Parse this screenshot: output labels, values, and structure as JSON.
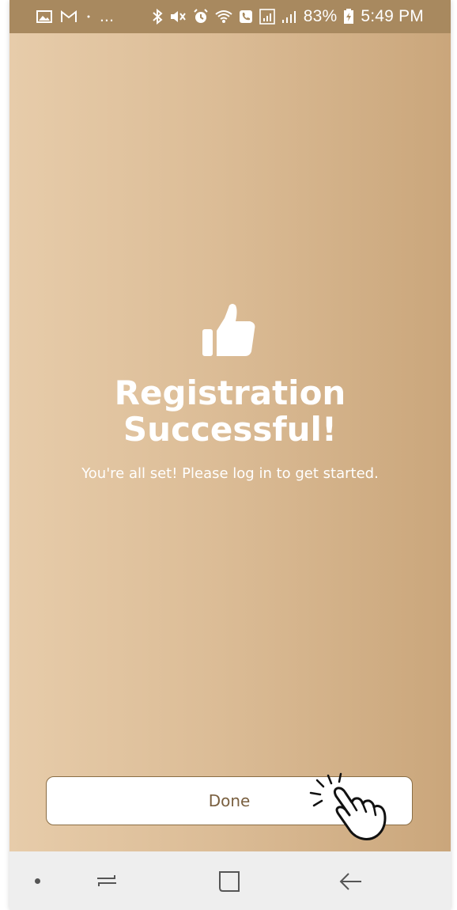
{
  "status_bar": {
    "overflow_dots": "...",
    "battery_percent": "83%",
    "time": "5:49 PM",
    "icons": [
      "gallery-icon",
      "gmail-icon",
      "dot-icon",
      "bluetooth-icon",
      "mute-icon",
      "alarm-icon",
      "wifi-icon",
      "phone-icon",
      "signal-box-icon",
      "signal-bars-icon",
      "battery-charging-icon"
    ]
  },
  "success": {
    "icon": "thumbs-up-icon",
    "title_line1": "Registration",
    "title_line2": "Successful!",
    "message": "You're all set! Please log in to get started."
  },
  "actions": {
    "done_label": "Done"
  },
  "navigation": {
    "icons": [
      "nav-dot-icon",
      "recent-apps-icon",
      "home-icon",
      "back-icon"
    ]
  },
  "colors": {
    "status_bar": "#a8895f",
    "gradient_left": "#e7ccaa",
    "gradient_right": "#caa67b",
    "button_text": "#7a6040",
    "nav_bar": "#eeeeee"
  }
}
